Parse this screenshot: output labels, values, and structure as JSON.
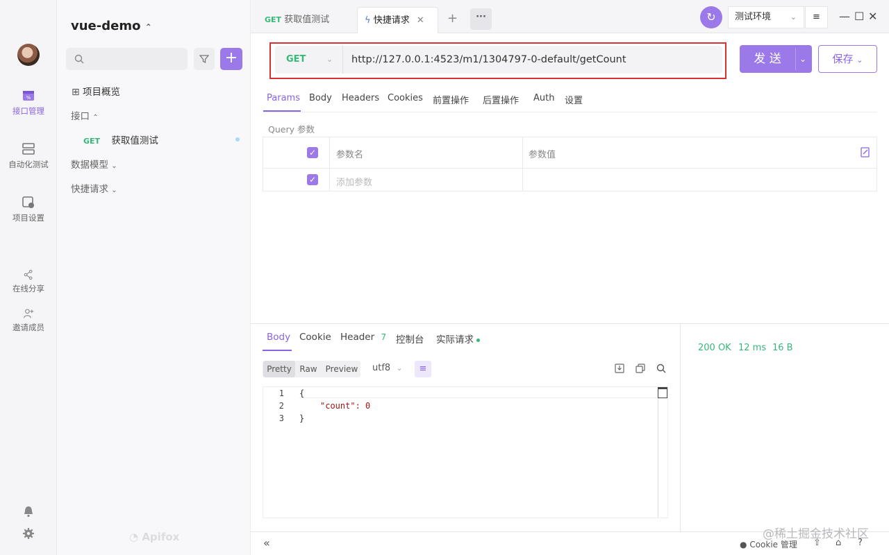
{
  "app": {
    "project_name": "vue-demo",
    "brand": "Apifox"
  },
  "rail": {
    "items": [
      {
        "label": "接口管理",
        "icon": "api-icon"
      },
      {
        "label": "自动化测试",
        "icon": "automation-icon"
      },
      {
        "label": "项目设置",
        "icon": "settings-icon"
      },
      {
        "label": "在线分享",
        "icon": "share-icon"
      },
      {
        "label": "邀请成员",
        "icon": "invite-icon"
      }
    ]
  },
  "sidebar": {
    "overview": "项目概览",
    "api_folder": "接口",
    "api_method": "GET",
    "api_name": "获取值测试",
    "data_models": "数据模型",
    "quick_requests": "快捷请求"
  },
  "tabs": [
    {
      "method": "GET",
      "label": "获取值测试"
    },
    {
      "label": "快捷请求",
      "active": true
    }
  ],
  "env": {
    "label": "测试环境"
  },
  "request": {
    "method": "GET",
    "url": "http://127.0.0.1:4523/m1/1304797-0-default/getCount",
    "send_label": "发 送",
    "save_label": "保存"
  },
  "req_tabs": [
    "Params",
    "Body",
    "Headers",
    "Cookies",
    "前置操作",
    "后置操作",
    "Auth",
    "设置"
  ],
  "params": {
    "section_label": "Query 参数",
    "col_name": "参数名",
    "col_value": "参数值",
    "add_placeholder": "添加参数"
  },
  "response": {
    "tabs": [
      "Body",
      "Cookie",
      "Header",
      "控制台",
      "实际请求"
    ],
    "header_count": "7",
    "formats": [
      "Pretty",
      "Raw",
      "Preview"
    ],
    "encoding": "utf8",
    "lines": [
      "1",
      "2",
      "3"
    ],
    "code": [
      "{",
      "\"count\": 0",
      "}"
    ],
    "status": "200 OK",
    "time": "12 ms",
    "size": "16 B"
  },
  "footer": {
    "cookie_label": "Cookie 管理"
  },
  "watermark": "@稀土掘金技术社区",
  "colors": {
    "accent": "#8a63e3",
    "get_method": "#34b978",
    "highlight_border": "#d93030"
  }
}
